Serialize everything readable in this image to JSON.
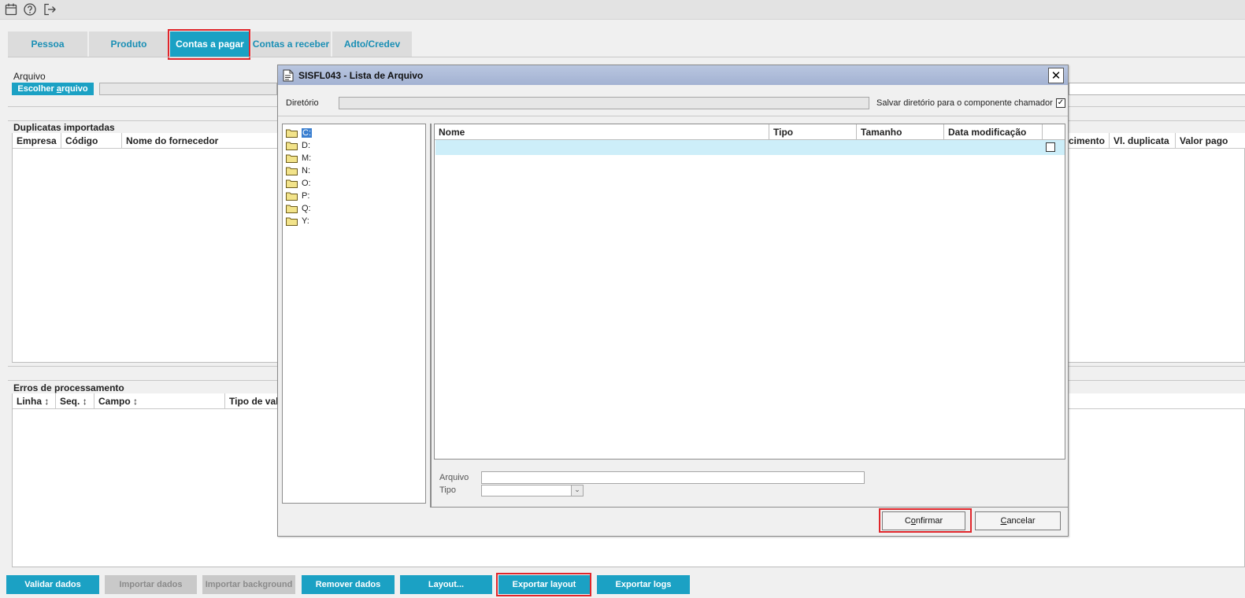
{
  "topbar": {
    "icons": [
      "calendar-icon",
      "help-icon",
      "logout-icon"
    ]
  },
  "tabs": [
    {
      "label": "Pessoa",
      "active": false
    },
    {
      "label": "Produto",
      "active": false
    },
    {
      "label": "Contas a pagar",
      "active": true
    },
    {
      "label": "Contas a receber",
      "active": false
    },
    {
      "label": "Adto/Credev",
      "active": false
    }
  ],
  "arquivo": {
    "label": "Arquivo",
    "choose_button_prefix": "Escolher ",
    "choose_button_underline": "a",
    "choose_button_suffix": "rquivo"
  },
  "duplicatas": {
    "title": "Duplicatas importadas",
    "columns_left": [
      "Empresa",
      "Código",
      "Nome do fornecedor"
    ],
    "columns_right": [
      "cimento",
      "Vl. duplicata",
      "Valor pago"
    ]
  },
  "erros": {
    "title": "Erros de processamento",
    "columns": [
      "Linha",
      "Seq.",
      "Campo",
      "Tipo de vali"
    ],
    "sort_glyph": "↕"
  },
  "bottom_buttons": [
    {
      "label": "Validar dados",
      "enabled": true
    },
    {
      "label": "Importar dados",
      "enabled": false
    },
    {
      "label": "Importar background",
      "enabled": false
    },
    {
      "label": "Remover dados",
      "enabled": true
    },
    {
      "label": "Layout...",
      "enabled": true
    },
    {
      "label": "Exportar layout",
      "enabled": true
    },
    {
      "label": "Exportar logs",
      "enabled": true
    }
  ],
  "dialog": {
    "title": "SISFL043 - Lista de Arquivo",
    "close_glyph": "✕",
    "diretorio_label": "Diretório",
    "diretorio_value": "",
    "save_dir_label": "Salvar diretório para o componente chamador",
    "save_dir_checked": true,
    "check_glyph": "✓",
    "drives": [
      "C:",
      "D:",
      "M:",
      "N:",
      "O:",
      "P:",
      "Q:",
      "Y:"
    ],
    "selected_drive": "C:",
    "file_columns": [
      "Nome",
      "Tipo",
      "Tamanho",
      "Data modificação"
    ],
    "arquivo_label": "Arquivo",
    "arquivo_value": "",
    "tipo_label": "Tipo",
    "tipo_value": "",
    "dropdown_glyph": "⌄",
    "confirm_prefix": "C",
    "confirm_underline": "o",
    "confirm_suffix": "nfirmar",
    "cancel_underline": "C",
    "cancel_suffix": "ancelar"
  },
  "colors": {
    "accent": "#1ba1c4",
    "highlight": "#e0262b",
    "selected_row": "#cdeef9",
    "dialog_title": "#a3b2d2"
  }
}
